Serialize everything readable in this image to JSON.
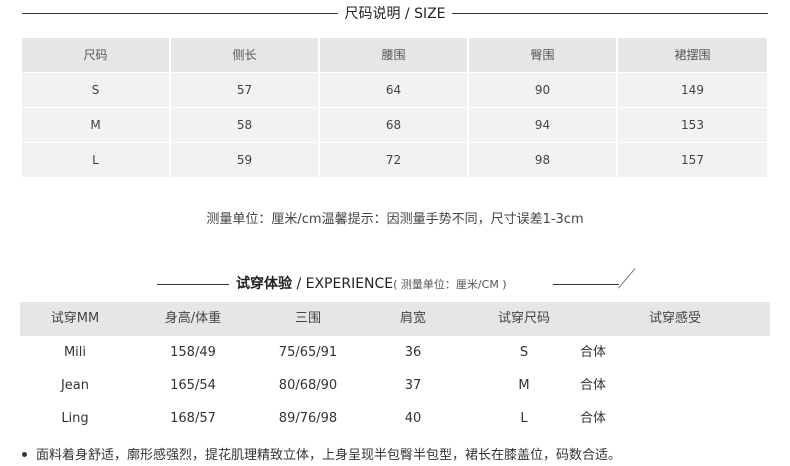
{
  "size_section": {
    "title": "尺码说明 / SIZE",
    "headers": [
      "尺码",
      "侧长",
      "腰围",
      "臀围",
      "裙摆围"
    ],
    "rows": [
      [
        "S",
        "57",
        "64",
        "90",
        "149"
      ],
      [
        "M",
        "58",
        "68",
        "94",
        "153"
      ],
      [
        "L",
        "59",
        "72",
        "98",
        "157"
      ]
    ],
    "note": "测量单位：厘米/cm温馨提示：因测量手势不同，尺寸误差1-3cm"
  },
  "experience_section": {
    "title_cn": "试穿体验",
    "title_en": " / EXPERIENCE",
    "title_unit": "( 测量单位：厘米/CM )",
    "headers": [
      "试穿MM",
      "身高/体重",
      "三围",
      "肩宽",
      "试穿尺码",
      "试穿感受"
    ],
    "rows": [
      [
        "Mili",
        "158/49",
        "75/65/91",
        "36",
        "S",
        "合体"
      ],
      [
        "Jean",
        "165/54",
        "80/68/90",
        "37",
        "M",
        "合体"
      ],
      [
        "Ling",
        "168/57",
        "89/76/98",
        "40",
        "L",
        "合体"
      ]
    ]
  },
  "description": "面料着身舒适，廓形感强烈，提花肌理精致立体，上身呈现半包臀半包型，裙长在膝盖位，码数合适。"
}
